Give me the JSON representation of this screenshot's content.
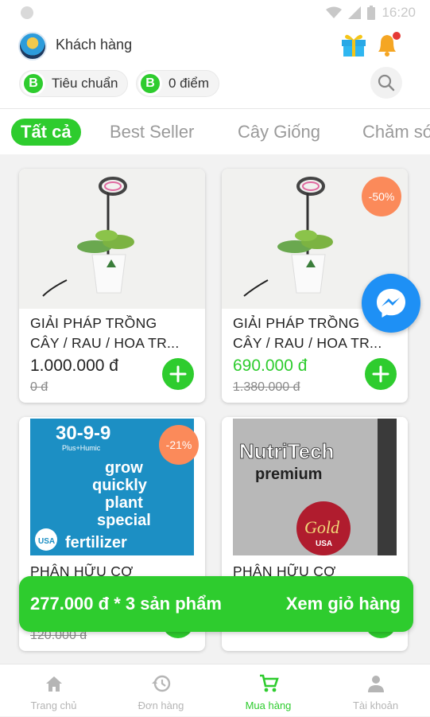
{
  "status_bar": {
    "time": "16:20"
  },
  "header": {
    "user_name": "Khách hàng",
    "tier_badge": "B",
    "tier_label": "Tiêu chuẩn",
    "points_badge": "B",
    "points_label": "0 điểm"
  },
  "tabs": [
    {
      "label": "Tất cả",
      "active": true
    },
    {
      "label": "Best Seller",
      "active": false
    },
    {
      "label": "Cây Giống",
      "active": false
    },
    {
      "label": "Chăm sóc",
      "active": false
    }
  ],
  "products": [
    {
      "title_line1": "GIẢI PHÁP TRỒNG",
      "title_line2": "CÂY / RAU / HOA TR...",
      "price": "1.000.000 đ",
      "old_price": "0 đ",
      "discount": "",
      "image": "grow-light-plant"
    },
    {
      "title_line1": "GIẢI PHÁP TRỒNG",
      "title_line2": "CÂY / RAU / HOA TR...",
      "price": "690.000 đ",
      "old_price": "1.380.000 đ",
      "discount": "-50%",
      "image": "grow-light-plant"
    },
    {
      "title_line1": "PHÂN HỮU CƠ",
      "title_line2": "",
      "price": "",
      "old_price": "120.000 đ",
      "discount": "-21%",
      "image": "fertilizer-bag-blue"
    },
    {
      "title_line1": "PHÂN HỮU CƠ",
      "title_line2": "",
      "price": "",
      "old_price": "",
      "discount": "",
      "image": "nutritech-bag"
    }
  ],
  "product_images": {
    "blue_bag": {
      "line1": "30-9-9",
      "line2": "Plus+Humic",
      "line3": "grow",
      "line4": "quickly",
      "line5": "plant",
      "line6": "special",
      "line7": "fertilizer",
      "seal": "USA"
    },
    "nutritech": {
      "brand": "NutriTech",
      "sub": "premium",
      "gold": "Gold",
      "gold_sub": "USA"
    }
  },
  "cart": {
    "summary": "277.000 đ  * 3 sản phẩm",
    "view_label": "Xem giỏ hàng"
  },
  "bottom_nav": [
    {
      "label": "Trang chủ",
      "icon": "home-icon",
      "active": false
    },
    {
      "label": "Đơn hàng",
      "icon": "history-icon",
      "active": false
    },
    {
      "label": "Mua hàng",
      "icon": "cart-icon",
      "active": true
    },
    {
      "label": "Tài khoản",
      "icon": "person-icon",
      "active": false
    }
  ],
  "colors": {
    "accent": "#2ecc2e",
    "discount": "#fb8a5a",
    "messenger": "#1e90f5"
  }
}
